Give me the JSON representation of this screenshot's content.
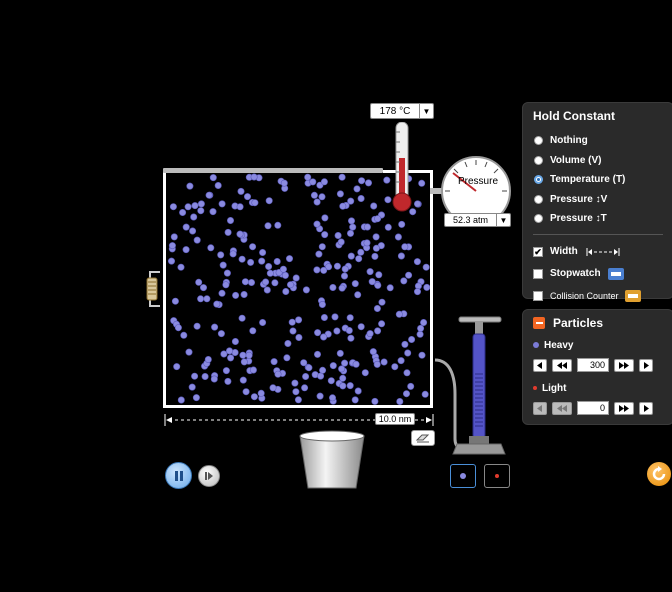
{
  "thermometer": {
    "readout": "178 °C"
  },
  "pressure_gauge": {
    "label": "Pressure",
    "readout": "52.3 atm"
  },
  "container": {
    "width_readout": "10.0 nm",
    "particle_count": 300
  },
  "hold_constant": {
    "title": "Hold Constant",
    "options": [
      {
        "label": "Nothing",
        "selected": false
      },
      {
        "label": "Volume (V)",
        "selected": false
      },
      {
        "label": "Temperature (T)",
        "selected": true
      },
      {
        "label": "Pressure ↕V",
        "selected": false
      },
      {
        "label": "Pressure ↕T",
        "selected": false
      }
    ],
    "checks": [
      {
        "label": "Width",
        "checked": true,
        "icon": "width-arrows-icon"
      },
      {
        "label": "Stopwatch",
        "checked": false,
        "icon": "stopwatch-icon"
      },
      {
        "label": "Collision Counter",
        "checked": false,
        "icon": "collision-counter-icon"
      }
    ]
  },
  "particles_panel": {
    "title": "Particles",
    "heavy": {
      "label": "Heavy",
      "value": "300",
      "color": "#7b7bd6"
    },
    "light": {
      "label": "Light",
      "value": "0",
      "color": "#e23b2e"
    }
  },
  "colors": {
    "panel_bg": "#2a2a2a",
    "accent_orange": "#f26522",
    "particle_heavy": "#8a8ae0",
    "selected_blue": "#4a8fd8"
  }
}
